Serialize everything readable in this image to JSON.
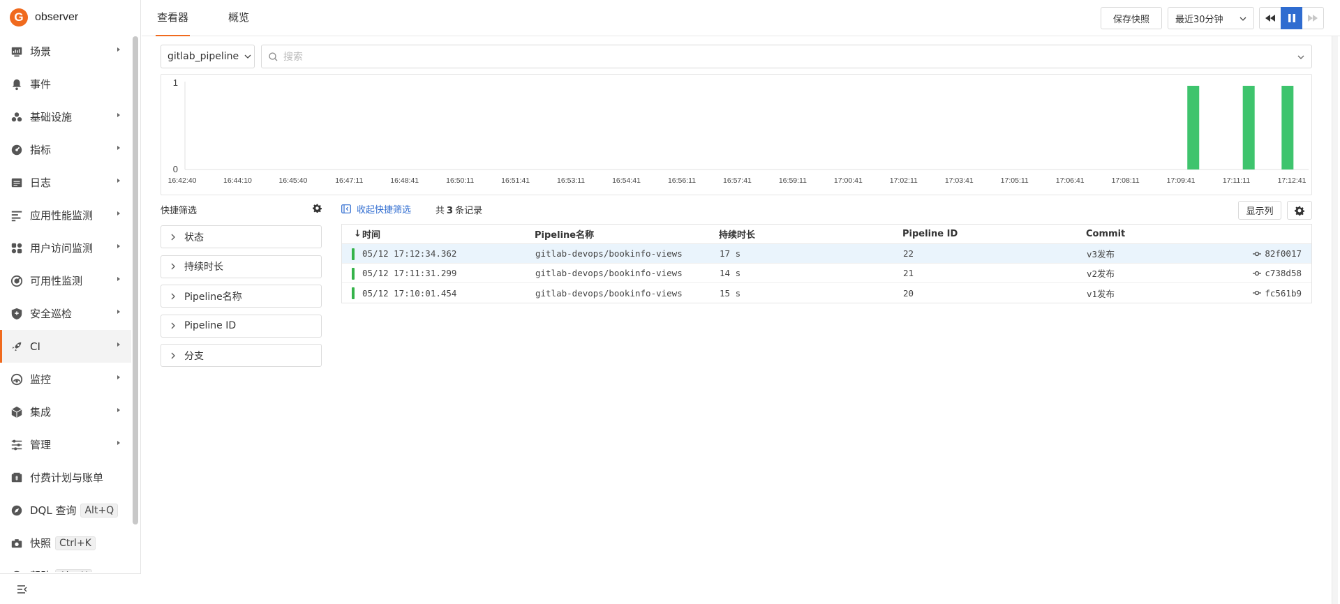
{
  "app": {
    "logo_letter": "G",
    "name": "observer"
  },
  "sidebar": {
    "items": [
      {
        "label": "场景",
        "icon": "dashboard-icon",
        "arrow": true
      },
      {
        "label": "事件",
        "icon": "bell-icon",
        "arrow": false
      },
      {
        "label": "基础设施",
        "icon": "infrastructure-icon",
        "arrow": true
      },
      {
        "label": "指标",
        "icon": "metrics-icon",
        "arrow": true
      },
      {
        "label": "日志",
        "icon": "log-icon",
        "arrow": true
      },
      {
        "label": "应用性能监测",
        "icon": "apm-icon",
        "arrow": true
      },
      {
        "label": "用户访问监测",
        "icon": "rum-icon",
        "arrow": true
      },
      {
        "label": "可用性监测",
        "icon": "dialing-icon",
        "arrow": true
      },
      {
        "label": "安全巡检",
        "icon": "shield-icon",
        "arrow": true
      },
      {
        "label": "CI",
        "icon": "rocket-icon",
        "arrow": true,
        "active": true
      },
      {
        "label": "监控",
        "icon": "monitor-icon",
        "arrow": true
      },
      {
        "label": "集成",
        "icon": "integration-icon",
        "arrow": true
      },
      {
        "label": "管理",
        "icon": "settings-sliders-icon",
        "arrow": true
      },
      {
        "label": "付费计划与账单",
        "icon": "billing-icon",
        "arrow": false
      },
      {
        "label": "DQL 查询",
        "icon": "compass-icon",
        "arrow": false,
        "shortcut": "Alt+Q"
      },
      {
        "label": "快照",
        "icon": "camera-icon",
        "arrow": false,
        "shortcut": "Ctrl+K"
      },
      {
        "label": "帮助",
        "icon": "help-icon",
        "arrow": false,
        "shortcut": "Alt+H"
      }
    ]
  },
  "header": {
    "tabs": [
      {
        "label": "查看器",
        "active": true
      },
      {
        "label": "概览",
        "active": false
      }
    ],
    "save_snapshot": "保存快照",
    "time_range": "最近30分钟"
  },
  "filter": {
    "source": "gitlab_pipeline",
    "search_placeholder": "搜索"
  },
  "chart_data": {
    "type": "bar",
    "y_ticks": [
      "1",
      "0"
    ],
    "ylim": [
      0,
      1
    ],
    "x_ticks": [
      "16:42:40",
      "16:44:10",
      "16:45:40",
      "16:47:11",
      "16:48:41",
      "16:50:11",
      "16:51:41",
      "16:53:11",
      "16:54:41",
      "16:56:11",
      "16:57:41",
      "16:59:11",
      "17:00:41",
      "17:02:11",
      "17:03:41",
      "17:05:11",
      "17:06:41",
      "17:08:11",
      "17:09:41",
      "17:11:11",
      "17:12:41"
    ],
    "series": [
      {
        "color": "#3ec46d",
        "points": [
          {
            "x": "17:10:01",
            "y": 1
          },
          {
            "x": "17:11:31",
            "y": 1
          },
          {
            "x": "17:12:34",
            "y": 1
          }
        ]
      }
    ]
  },
  "quick_filter": {
    "title": "快捷筛选",
    "items": [
      "状态",
      "持续时长",
      "Pipeline名称",
      "Pipeline ID",
      "分支"
    ]
  },
  "table": {
    "collapse_label": "收起快捷筛选",
    "count_prefix": "共",
    "count": "3",
    "count_suffix": "条记录",
    "show_columns": "显示列",
    "columns": [
      "时间",
      "Pipeline名称",
      "持续时长",
      "Pipeline ID",
      "Commit"
    ],
    "rows": [
      {
        "time": "05/12 17:12:34.362",
        "name": "gitlab-devops/bookinfo-views",
        "duration": "17 s",
        "id": "22",
        "commit": "v3发布",
        "hash": "82f0017",
        "status_color": "#35b34a"
      },
      {
        "time": "05/12 17:11:31.299",
        "name": "gitlab-devops/bookinfo-views",
        "duration": "14 s",
        "id": "21",
        "commit": "v2发布",
        "hash": "c738d58",
        "status_color": "#35b34a"
      },
      {
        "time": "05/12 17:10:01.454",
        "name": "gitlab-devops/bookinfo-views",
        "duration": "15 s",
        "id": "20",
        "commit": "v1发布",
        "hash": "fc561b9",
        "status_color": "#35b34a"
      }
    ]
  }
}
